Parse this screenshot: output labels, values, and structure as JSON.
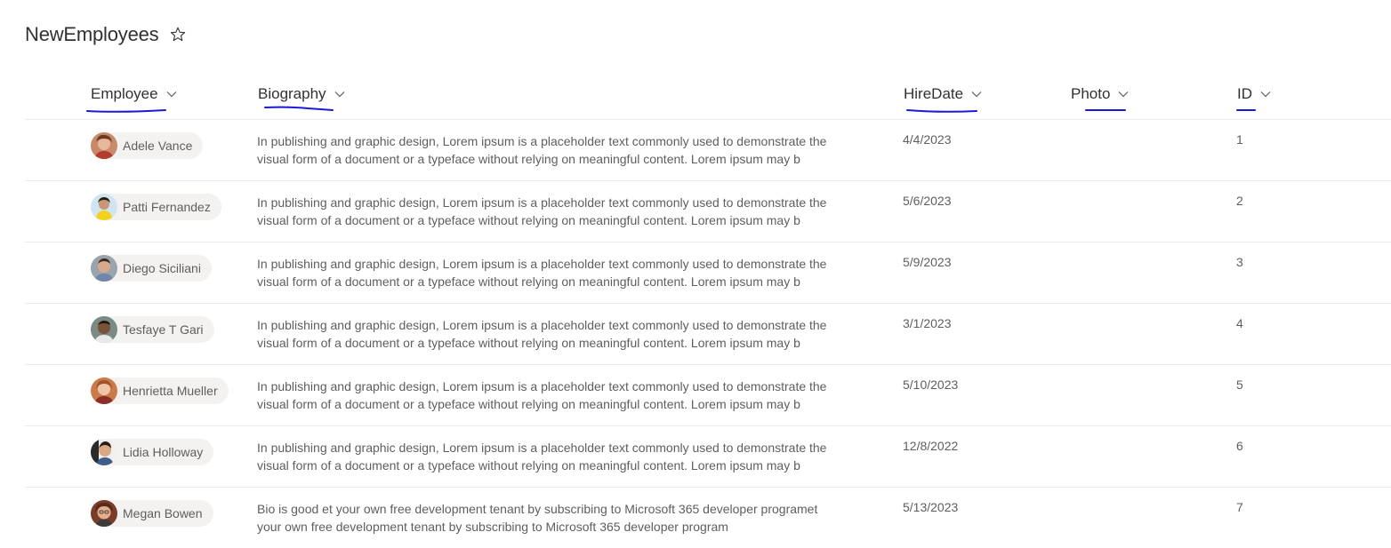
{
  "list": {
    "title": "NewEmployees"
  },
  "columns": [
    {
      "label": "Employee"
    },
    {
      "label": "Biography"
    },
    {
      "label": "HireDate"
    },
    {
      "label": "Photo"
    },
    {
      "label": "ID"
    }
  ],
  "rows": [
    {
      "employee": "Adele Vance",
      "bio_line1": "In publishing and graphic design, Lorem ipsum is a placeholder text commonly used to demonstrate the",
      "bio_line2": "visual form of a document or a typeface without relying on meaningful content. Lorem ipsum may b",
      "hire_date": "4/4/2023",
      "photo": "",
      "id": "1"
    },
    {
      "employee": "Patti Fernandez",
      "bio_line1": "In publishing and graphic design, Lorem ipsum is a placeholder text commonly used to demonstrate the",
      "bio_line2": "visual form of a document or a typeface without relying on meaningful content. Lorem ipsum may b",
      "hire_date": "5/6/2023",
      "photo": "",
      "id": "2"
    },
    {
      "employee": "Diego Siciliani",
      "bio_line1": "In publishing and graphic design, Lorem ipsum is a placeholder text commonly used to demonstrate the",
      "bio_line2": "visual form of a document or a typeface without relying on meaningful content. Lorem ipsum may b",
      "hire_date": "5/9/2023",
      "photo": "",
      "id": "3"
    },
    {
      "employee": "Tesfaye T Gari",
      "bio_line1": "In publishing and graphic design, Lorem ipsum is a placeholder text commonly used to demonstrate the",
      "bio_line2": "visual form of a document or a typeface without relying on meaningful content. Lorem ipsum may b",
      "hire_date": "3/1/2023",
      "photo": "",
      "id": "4"
    },
    {
      "employee": "Henrietta Mueller",
      "bio_line1": "In publishing and graphic design, Lorem ipsum is a placeholder text commonly used to demonstrate the",
      "bio_line2": "visual form of a document or a typeface without relying on meaningful content. Lorem ipsum may b",
      "hire_date": "5/10/2023",
      "photo": "",
      "id": "5"
    },
    {
      "employee": "Lidia Holloway",
      "bio_line1": "In publishing and graphic design, Lorem ipsum is a placeholder text commonly used to demonstrate the",
      "bio_line2": "visual form of a document or a typeface without relying on meaningful content. Lorem ipsum may b",
      "hire_date": "12/8/2022",
      "photo": "",
      "id": "6"
    },
    {
      "employee": "Megan Bowen",
      "bio_line1": "Bio is good et your own free development tenant by subscribing to Microsoft 365 developer programet",
      "bio_line2": "your own free development tenant by subscribing to Microsoft 365 developer program",
      "hire_date": "5/13/2023",
      "photo": "",
      "id": "7"
    }
  ],
  "icons": {
    "favorite": "star-outline-icon",
    "sort": "chevron-down-icon"
  },
  "colors": {
    "annotation_underline": "#1a1ad6",
    "divider": "#edebe9",
    "persona_bg": "#f3f2f1",
    "text": "#323130",
    "subtle_text": "#605e5c"
  }
}
